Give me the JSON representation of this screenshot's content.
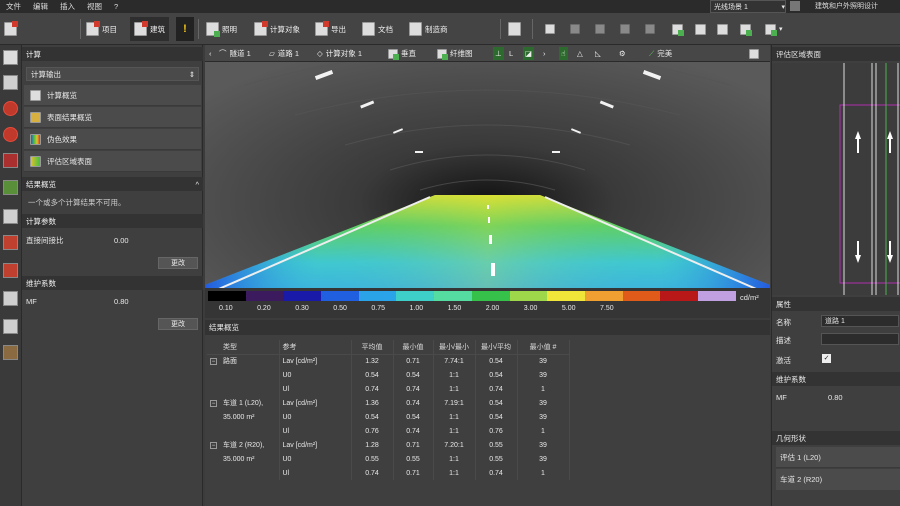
{
  "menu": [
    "文件",
    "编辑",
    "插入",
    "视图",
    "?"
  ],
  "toolbar": {
    "project": "项目",
    "building": "建筑",
    "lights": "照明",
    "calc_objects": "计算对象",
    "export": "导出",
    "documents": "文档",
    "manufacturer": "制造商",
    "scene_select": "光线场景 1",
    "mode": "建筑和户外照明设计"
  },
  "left": {
    "calc_header": "计算",
    "calc_output": "计算输出",
    "nav": [
      "计算概览",
      "表面结果概览",
      "伪色效果",
      "评估区域表面"
    ],
    "results_header": "结果概览",
    "results_msg": "一个或多个计算结果不可用。",
    "params_header": "计算参数",
    "direct_ratio_label": "直接间接比",
    "direct_ratio_value": "0.00",
    "update": "更改",
    "maint_header": "维护系数",
    "mf_label": "MF",
    "mf_value": "0.80"
  },
  "view": {
    "tabs": [
      "隧道 1",
      "道路 1",
      "计算对象 1"
    ],
    "buttons": [
      "垂直",
      "纤维图",
      "完美"
    ]
  },
  "legend": {
    "unit": "cd/m²",
    "colors": [
      "#000000",
      "#3b1a5e",
      "#1a1aa8",
      "#1f5fe0",
      "#2aa3e8",
      "#3ed0c8",
      "#55dca0",
      "#36c24a",
      "#9ed84a",
      "#f0e63a",
      "#f0a030",
      "#e05a1a",
      "#b81818",
      "#c0a0e0"
    ],
    "labels": [
      "0.10",
      "0.20",
      "0.30",
      "0.50",
      "0.75",
      "1.00",
      "1.50",
      "2.00",
      "3.00",
      "5.00",
      "7.50"
    ]
  },
  "results": {
    "header": "结果概览",
    "columns": [
      "类型",
      "参考",
      "平均值",
      "最小值",
      "最小/最小",
      "最小/平均",
      "最小值 #"
    ],
    "groups": [
      {
        "name": "路面",
        "sub": "",
        "rows": [
          [
            "Lav [cd/m²]",
            "1.32",
            "0.71",
            "7.74:1",
            "0.54",
            "39"
          ],
          [
            "U0",
            "0.54",
            "0.54",
            "1:1",
            "0.54",
            "39"
          ],
          [
            "Ul",
            "0.74",
            "0.74",
            "1:1",
            "0.74",
            "1"
          ]
        ]
      },
      {
        "name": "车道 1 (L20),",
        "sub": "35.000 m²",
        "rows": [
          [
            "Lav [cd/m²]",
            "1.36",
            "0.74",
            "7.19:1",
            "0.54",
            "39"
          ],
          [
            "U0",
            "0.54",
            "0.54",
            "1:1",
            "0.54",
            "39"
          ],
          [
            "Ul",
            "0.76",
            "0.74",
            "1:1",
            "0.76",
            "1"
          ]
        ]
      },
      {
        "name": "车道 2 (R20),",
        "sub": "35.000 m²",
        "rows": [
          [
            "Lav [cd/m²]",
            "1.28",
            "0.71",
            "7.20:1",
            "0.55",
            "39"
          ],
          [
            "U0",
            "0.55",
            "0.55",
            "1:1",
            "0.55",
            "39"
          ],
          [
            "Ul",
            "0.74",
            "0.71",
            "1:1",
            "0.74",
            "1"
          ]
        ]
      }
    ]
  },
  "right": {
    "eval_header": "评估区域表面",
    "props_header": "属性",
    "name_label": "名称",
    "name_value": "道路 1",
    "desc_label": "描述",
    "active_label": "激活",
    "maint_header": "维护系数",
    "mf_label": "MF",
    "mf_value": "0.80",
    "geom_header": "几何形状",
    "geom_items": [
      "评估 1 (L20)",
      "车道 2 (R20)"
    ]
  }
}
